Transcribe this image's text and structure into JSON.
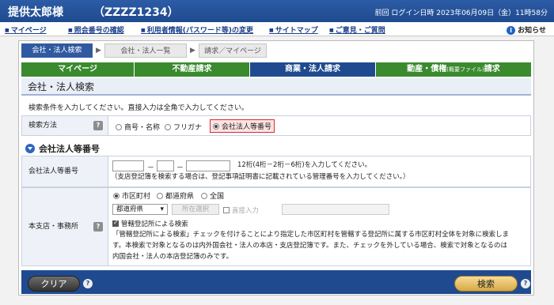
{
  "header": {
    "user_name": "提供太郎様",
    "user_id": "（ZZZZ1234）",
    "login_info": "前回 ログイン日時 2023年06月09日（金）11時58分"
  },
  "menu": {
    "items": [
      "マイページ",
      "照会番号の確認",
      "利用者情報(パスワード等)の変更",
      "サイトマップ",
      "ご意見・ご質問"
    ],
    "notice": "お知らせ"
  },
  "breadcrumbs": {
    "step1": "会社・法人検索",
    "step2": "会社・法人一覧",
    "step3": "請求／マイページ"
  },
  "tabs": {
    "mypage": "マイページ",
    "realestate": "不動産請求",
    "commercial": "商業・法人請求",
    "movable_prefix": "動産・債権",
    "movable_small": "(概要ファイル)",
    "movable_suffix": "請求"
  },
  "page": {
    "title": "会社・法人検索",
    "instruction": "検索条件を入力してください。直接入力は全角で入力してください。"
  },
  "search_method": {
    "label": "検索方法",
    "help": "?",
    "options": [
      "商号・名称",
      "フリガナ",
      "会社法人等番号"
    ],
    "selected": "会社法人等番号"
  },
  "section": {
    "heading": "会社法人等番号"
  },
  "corp_number": {
    "label": "会社法人等番号",
    "dash": "－",
    "note1": "12桁(4桁－2桁－6桁)を入力してください。",
    "note2": "（支店登記簿を検索する場合は、登記事項証明書に記載されている管理番号を入力してください。）"
  },
  "office": {
    "label": "本支店・事務所",
    "help": "?",
    "scope_options": [
      "市区町村",
      "都道府県",
      "全国"
    ],
    "scope_selected": "市区町村",
    "prefecture_select": "都道府県",
    "location_button": "所在選択",
    "direct_input": "直接入力",
    "jurisdiction_checkbox": "管轄登記所による検索",
    "description_line1": "「管轄登記所による検索」チェックを付けることにより指定した市区町村を管轄する登記所に属する市区町村全体を対象に検索しま",
    "description_line2": "す。本検索で対象となるのは内外国会社・法人の本店・支店登記簿です。また、チェックを外している場合、検索で対象となるのは",
    "description_line3": "内国会社・法人の本店登記簿のみです。"
  },
  "footer": {
    "clear": "クリア",
    "search": "検索",
    "help": "?"
  },
  "colors": {
    "brand_blue": "#1f4a8f",
    "tab_green": "#3a8a2e",
    "highlight_red": "#d23030"
  }
}
